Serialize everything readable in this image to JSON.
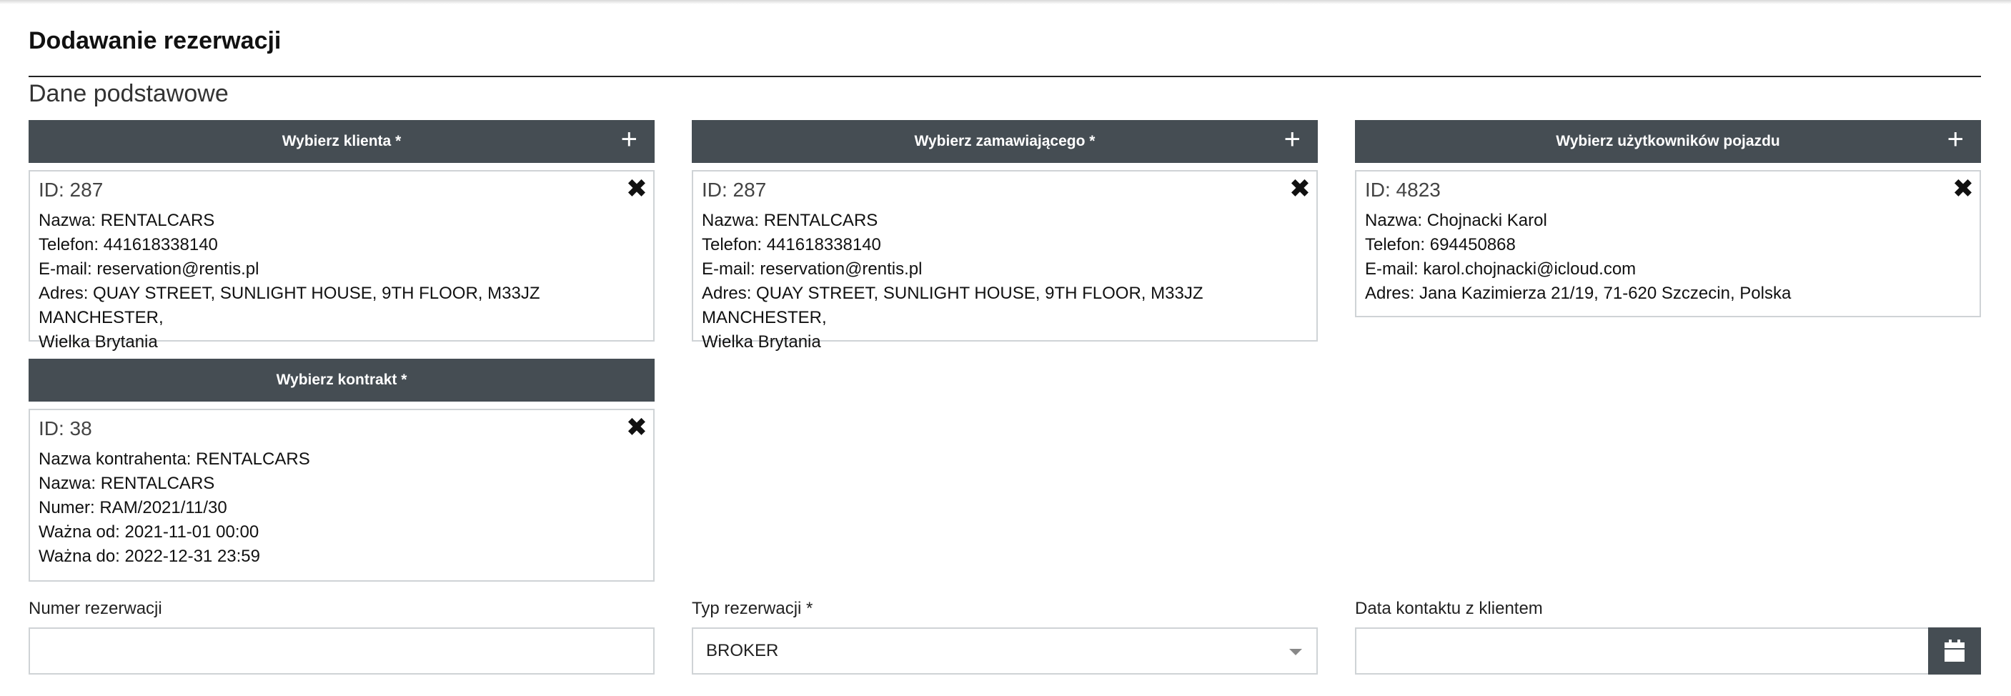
{
  "header": {
    "page_title": "Dodawanie rezerwacji",
    "section_title": "Dane podstawowe"
  },
  "client": {
    "button_label": "Wybierz klienta *",
    "id": "ID: 287",
    "lines": [
      "Nazwa: RENTALCARS",
      "Telefon: 441618338140",
      "E-mail: reservation@rentis.pl",
      "Adres: QUAY STREET, SUNLIGHT HOUSE, 9TH FLOOR, M33JZ MANCHESTER,",
      "Wielka Brytania"
    ]
  },
  "orderer": {
    "button_label": "Wybierz zamawiającego *",
    "id": "ID: 287",
    "lines": [
      "Nazwa: RENTALCARS",
      "Telefon: 441618338140",
      "E-mail: reservation@rentis.pl",
      "Adres: QUAY STREET, SUNLIGHT HOUSE, 9TH FLOOR, M33JZ MANCHESTER,",
      "Wielka Brytania"
    ]
  },
  "vehicle_users": {
    "button_label": "Wybierz użytkowników pojazdu",
    "id": "ID: 4823",
    "lines": [
      "Nazwa: Chojnacki Karol",
      "Telefon: 694450868",
      "E-mail: karol.chojnacki@icloud.com",
      "Adres: Jana Kazimierza 21/19, 71-620 Szczecin, Polska"
    ]
  },
  "contract": {
    "button_label": "Wybierz kontrakt *",
    "id": "ID: 38",
    "lines": [
      "Nazwa kontrahenta: RENTALCARS",
      "Nazwa: RENTALCARS",
      "Numer: RAM/2021/11/30",
      "Ważna od: 2021-11-01 00:00",
      "Ważna do: 2022-12-31 23:59"
    ]
  },
  "icons": {
    "plus": "+",
    "close": "✖"
  },
  "fields": {
    "reservation_number": {
      "label": "Numer rezerwacji",
      "value": ""
    },
    "reservation_type": {
      "label": "Typ rezerwacji *",
      "value": "BROKER"
    },
    "contact_date": {
      "label": "Data kontaktu z klientem",
      "value": ""
    }
  }
}
